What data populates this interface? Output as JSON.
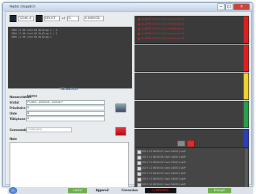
{
  "window": {
    "title": "Radio Dispatch",
    "controls": {
      "min": "–",
      "max": "□",
      "close": "×"
    }
  },
  "toolbar": {
    "field1": "1234E+F",
    "field2": "DRLIGT",
    "field3_label": "x4",
    "field3": "B",
    "field4": "0.0000 DB"
  },
  "log": {
    "lines": [
      "1900 12 06 Card 60 ObjDiag 1 / 1",
      "1900 12 06 Card 60 ObjDiag 1 / 1",
      "1900 12 06 Card 60 ObjDiag 1"
    ]
  },
  "form": {
    "section_title": "Situation",
    "fields": [
      {
        "label": "Nomenclature",
        "value": "Bulldog"
      },
      {
        "label": "Statut",
        "value": "Prudent - DirectEE - Central P"
      },
      {
        "label": "Prioritaire",
        "value": "B"
      },
      {
        "label": "Date",
        "value": "B"
      },
      {
        "label": "Téléphone",
        "value": "B"
      }
    ],
    "commande_label": "Commande",
    "commande_value": "COMMANDE",
    "note_label": "Note"
  },
  "alarms": [
    "ALARME 2019 12 06 Commande 03",
    "ALARME 2019 12 06 Commande 04",
    "ALARME 2019 12 06 Commande 05",
    "ALARME 2019 12 06 Commande 06",
    "ALARME 2019 12 06 Commande 07"
  ],
  "levels": [
    {
      "color": "#e02020"
    },
    {
      "color": "#f2d32a"
    },
    {
      "color": "#2aa04a"
    },
    {
      "color": "#2a3ec2"
    }
  ],
  "history": [
    "2019 12 06 08:57 Card 24000 / ValP",
    "2019 12 06 08:56 Card 24000 / ValP",
    "2019 12 06 08:55 Card 24000 / ValP",
    "2019 12 06 08:54 Card 24000 / ValP",
    "2019 12 06 08:53 Card 24000 / ValP",
    "2019 12 06 08:52 Card 24000 / ValP",
    "2019 12 06 08:51 Card 24000 / ValP"
  ],
  "statusbar": {
    "btn_left": "Lancer",
    "label1": "Appareil",
    "label2": "Connexion",
    "btn_alert": "COMMANDE",
    "btn_right": "Envoyer"
  }
}
